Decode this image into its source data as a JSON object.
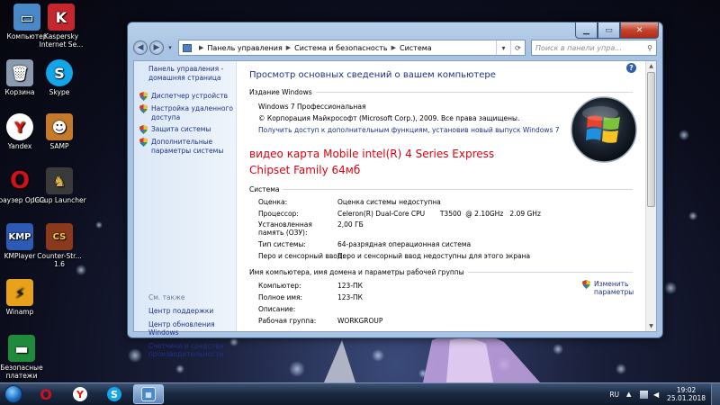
{
  "desktop": {
    "icons": [
      {
        "label": "Компьютер",
        "icon": "computer-icon",
        "color": "#4a89c8"
      },
      {
        "label": "Kaspersky Internet Se...",
        "icon": "kaspersky-icon",
        "color": "#c6262e"
      },
      {
        "label": "Корзина",
        "icon": "recycle-bin-icon",
        "color": "#8a9bb0"
      },
      {
        "label": "Skype",
        "icon": "skype-icon",
        "color": "#12a5e9"
      },
      {
        "label": "Yandex",
        "icon": "yandex-icon",
        "color": "#ffffff"
      },
      {
        "label": "SAMP",
        "icon": "samp-icon",
        "color": "#c47a2a"
      },
      {
        "label": "Браузер Opera",
        "icon": "opera-icon",
        "color": "#d0111b"
      },
      {
        "label": "ICCup Launcher",
        "icon": "iccup-icon",
        "color": "#3a3a3a"
      },
      {
        "label": "KMPlayer",
        "icon": "kmplayer-icon",
        "color": "#2c5ab5"
      },
      {
        "label": "Counter-Str... 1.6",
        "icon": "counter-strike-icon",
        "color": "#8a3a1a"
      },
      {
        "label": "Winamp",
        "icon": "winamp-icon",
        "color": "#e8a11a"
      },
      {
        "label": "Безопасные платежи",
        "icon": "safe-money-icon",
        "color": "#1f8a3c"
      }
    ]
  },
  "window": {
    "address": {
      "crumbs": [
        "Панель управления",
        "Система и безопасность",
        "Система"
      ]
    },
    "search_placeholder": "Поиск в панели упра...",
    "left_pane": {
      "home": "Панель управления - домашняя страница",
      "links": [
        "Диспетчер устройств",
        "Настройка удаленного доступа",
        "Защита системы",
        "Дополнительные параметры системы"
      ],
      "see_also_title": "См. также",
      "see_also": [
        "Центр поддержки",
        "Центр обновления Windows",
        "Счетчики и средства производительности"
      ]
    },
    "main": {
      "title": "Просмотр основных сведений о вашем компьютере",
      "edition_head": "Издание Windows",
      "edition": "Windows 7 Профессиональная",
      "copyright": "© Корпорация Майкрософт (Microsoft Corp.), 2009. Все права защищены.",
      "more_features": "Получить доступ к дополнительным функциям, установив новый выпуск Windows 7",
      "overlay_line1": "видео карта Mobile intel(R) 4 Series Express",
      "overlay_line2": "Chipset Family 64мб",
      "system_head": "Система",
      "system_rows": [
        {
          "label": "Оценка:",
          "value": "Оценка системы недоступна",
          "link": true
        },
        {
          "label": "Процессор:",
          "value": "Celeron(R) Dual-Core CPU       T3500  @ 2.10GHz   2.09 GHz",
          "link": false
        },
        {
          "label": "Установленная память (ОЗУ):",
          "value": "2,00 ГБ",
          "link": false
        },
        {
          "label": "Тип системы:",
          "value": "64-разрядная операционная система",
          "link": false
        },
        {
          "label": "Перо и сенсорный ввод:",
          "value": "Перо и сенсорный ввод недоступны для этого экрана",
          "link": false
        }
      ],
      "name_head": "Имя компьютера, имя домена и параметры рабочей группы",
      "name_rows": [
        {
          "label": "Компьютер:",
          "value": "123-ПК"
        },
        {
          "label": "Полное имя:",
          "value": "123-ПК"
        },
        {
          "label": "Описание:",
          "value": ""
        },
        {
          "label": "Рабочая группа:",
          "value": "WORKGROUP"
        }
      ],
      "change_link": "Изменить параметры"
    }
  },
  "taskbar": {
    "items": [
      {
        "icon": "opera-icon",
        "color": "#d0111b",
        "active": false
      },
      {
        "icon": "yandex-icon",
        "color": "#ffffff",
        "active": false
      },
      {
        "icon": "skype-icon",
        "color": "#12a5e9",
        "active": false
      },
      {
        "icon": "control-panel-icon",
        "color": "#4a89c8",
        "active": true
      }
    ],
    "lang": "RU",
    "time": "19:02",
    "date": "25.01.2018"
  }
}
